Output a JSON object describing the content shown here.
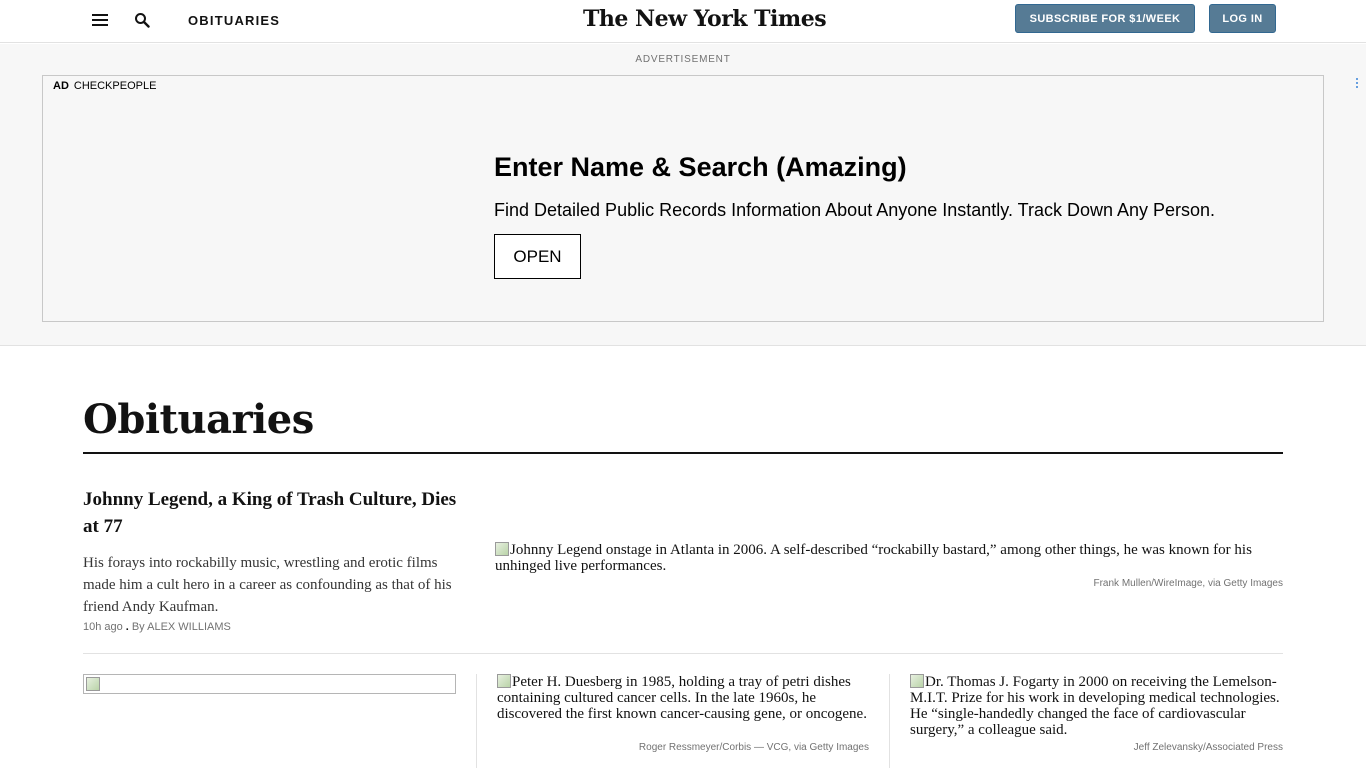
{
  "header": {
    "section_label": "OBITUARIES",
    "masthead": "The New York Times",
    "subscribe_label": "SUBSCRIBE FOR $1/WEEK",
    "login_label": "LOG IN"
  },
  "ad": {
    "label": "ADVERTISEMENT",
    "tag": "AD",
    "advertiser": "CHECKPEOPLE",
    "headline": "Enter Name & Search (Amazing)",
    "body": "Find Detailed Public Records Information About Anyone Instantly. Track Down Any Person.",
    "cta_label": "OPEN"
  },
  "page": {
    "title": "Obituaries"
  },
  "lead_story": {
    "headline": "Johnny Legend, a King of Trash Culture, Dies at 77",
    "summary": "His forays into rockabilly music, wrestling and erotic films made him a cult hero in a career as confounding as that of his friend Andy Kaufman.",
    "time": "10h ago",
    "byline": "By ALEX WILLIAMS",
    "image_alt": "Johnny Legend onstage in Atlanta in 2006. A self-described “rockabilly bastard,” among other things, he was known for his unhinged live performances.",
    "image_credit": "Frank Mullen/WireImage, via Getty Images"
  },
  "cards": [
    {
      "image_alt": "",
      "image_credit": ""
    },
    {
      "image_alt": "Peter H. Duesberg in 1985, holding a tray of petri dishes containing cultured cancer cells. In the late 1960s, he discovered the first known cancer-causing gene, or oncogene.",
      "image_credit": "Roger Ressmeyer/Corbis — VCG, via Getty Images"
    },
    {
      "image_alt": "Dr. Thomas J. Fogarty in 2000 on receiving the Lemelson-M.I.T. Prize for his work in developing medical technologies. He “single-handedly changed the face of cardiovascular surgery,” a colleague said.",
      "image_credit": "Jeff Zelevansky/Associated Press"
    }
  ],
  "colors": {
    "button_bg": "#567b95",
    "ad_bg": "#f7f7f7",
    "text": "#121212",
    "muted": "#727272"
  },
  "icons": [
    "hamburger-menu-icon",
    "search-icon",
    "ad-options-icon",
    "broken-image-icon"
  ]
}
